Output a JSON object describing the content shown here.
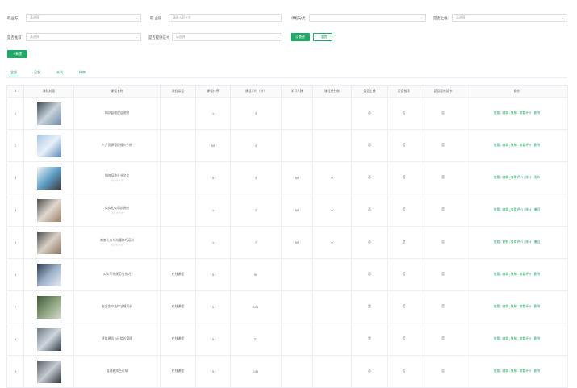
{
  "filters": {
    "row1": [
      {
        "label": "职业方：",
        "placeholder": "请选择"
      },
      {
        "label": "职 业级",
        "placeholder": "请输入职业名"
      },
      {
        "label": "课程分类",
        "placeholder": ""
      },
      {
        "label": "是否上线：",
        "placeholder": "请选择"
      }
    ],
    "row2": [
      {
        "label": "是否推荐",
        "placeholder": "请选择"
      },
      {
        "label": "是否提供证书",
        "placeholder": "请选择"
      }
    ],
    "search_label": "Q 查询",
    "reset_label": "◌ 重置"
  },
  "toolbar": {
    "add_label": "+ 新增"
  },
  "tabs": [
    "全部",
    "已发",
    "未发",
    "待审"
  ],
  "table": {
    "headers": [
      "#",
      "课程封面",
      "课程名称",
      "课程类型",
      "课程排序",
      "课程学时（分）",
      "学习人数",
      "课程评分数",
      "是否上线",
      "是否推荐",
      "是否提供证书",
      "操作"
    ],
    "rows": [
      {
        "idx": "1",
        "name": "知识管理建设说明",
        "stars": "",
        "type": "",
        "sort": "1",
        "hours": "3",
        "learners": "",
        "score": "",
        "online": "否",
        "recommend": "否",
        "cert": "否"
      },
      {
        "idx": "2",
        "name": "人力资源管理操作手册",
        "stars": "",
        "type": "",
        "sort": "55",
        "hours": "4",
        "learners": "",
        "score": "",
        "online": "否",
        "recommend": "否",
        "cert": "否"
      },
      {
        "idx": "3",
        "name": "如何培养企业文化",
        "stars": "☆☆☆☆☆",
        "type": "",
        "sort": "5",
        "hours": "3",
        "learners": "65",
        "score": "0",
        "online": "否",
        "recommend": "否",
        "cert": "否"
      },
      {
        "idx": "4",
        "name": "商务礼仪培训讲座",
        "stars": "☆☆☆☆☆",
        "type": "",
        "sort": "1",
        "hours": "2",
        "learners": "69",
        "score": "0",
        "online": "否",
        "recommend": "否",
        "cert": "否"
      },
      {
        "idx": "5",
        "name": "商务礼仪与沟通技巧培训",
        "stars": "☆☆☆☆☆",
        "type": "",
        "sort": "1",
        "hours": "7",
        "learners": "69",
        "score": "0",
        "online": "否",
        "recommend": "是",
        "cert": "否"
      },
      {
        "idx": "6",
        "name": "公文写作规范与技巧",
        "stars": "",
        "type": "在线课程",
        "sort": "5",
        "hours": "90",
        "learners": "",
        "score": "",
        "online": "否",
        "recommend": "否",
        "cert": "否"
      },
      {
        "idx": "7",
        "name": "安全生产法律法规培训",
        "stars": "",
        "type": "在线课程",
        "sort": "5",
        "hours": "123",
        "learners": "",
        "score": "",
        "online": "是",
        "recommend": "否",
        "cert": "否"
      },
      {
        "idx": "8",
        "name": "班组建设与班组长管理",
        "stars": "",
        "type": "在线课程",
        "sort": "5",
        "hours": "37",
        "learners": "",
        "score": "",
        "online": "是",
        "recommend": "否",
        "cert": "否"
      },
      {
        "idx": "9",
        "name": "管理者角色认知",
        "stars": "",
        "type": "在线课程",
        "sort": "5",
        "hours": "136",
        "learners": "",
        "score": "",
        "online": "否",
        "recommend": "否",
        "cert": "否"
      }
    ],
    "ops": [
      [
        "查看",
        "编辑",
        "复制",
        "查看评价",
        "删除"
      ],
      [
        "查看",
        "编辑",
        "复制",
        "查看评价",
        "删除"
      ],
      [
        "查看",
        "编辑",
        "查看评价",
        "统计",
        "发布"
      ],
      [
        "查看",
        "编辑",
        "查看评价",
        "统计",
        "撤回"
      ],
      [
        "查看",
        "复制",
        "查看评价",
        "统计",
        "撤回"
      ],
      [
        "查看",
        "编辑",
        "复制",
        "查看评价",
        "删除"
      ],
      [
        "查看",
        "编辑",
        "复制",
        "查看评价",
        "删除"
      ],
      [
        "查看",
        "编辑",
        "复制",
        "查看评价",
        "删除"
      ],
      [
        "查看",
        "编辑",
        "复制",
        "查看评价",
        "删除"
      ]
    ]
  }
}
